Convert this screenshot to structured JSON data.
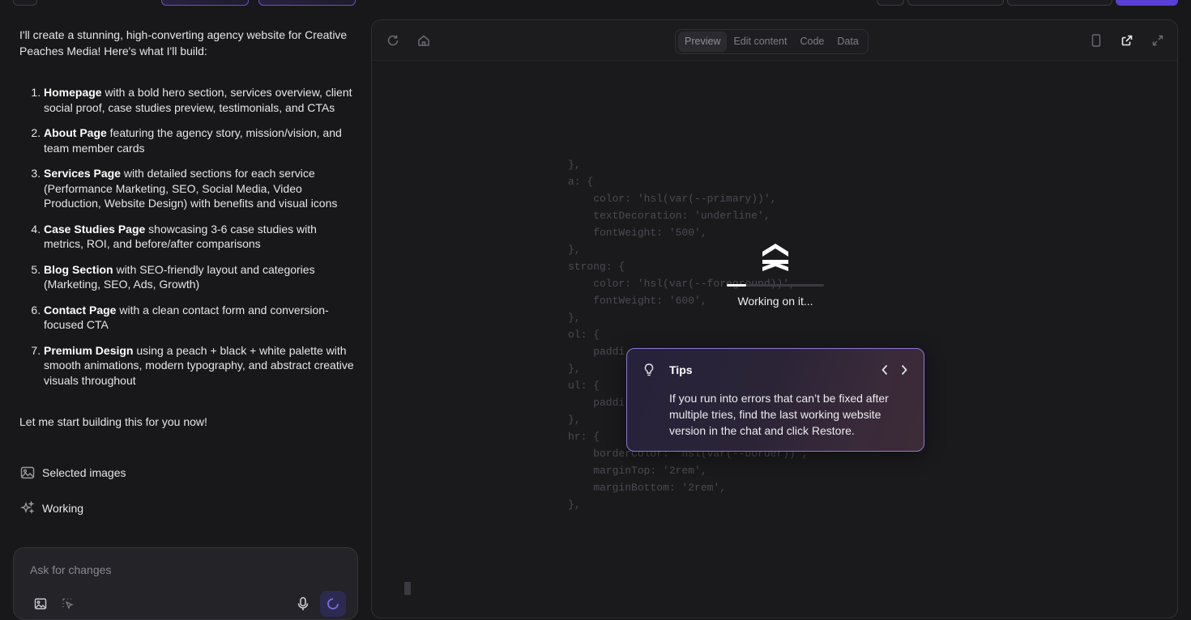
{
  "chat": {
    "intro": "I'll create a stunning, high-converting agency website for Creative Peaches Media! Here's what I'll build:",
    "items": [
      {
        "bold": "Homepage",
        "text": " with a bold hero section, services overview, client social proof, case studies preview, testimonials, and CTAs"
      },
      {
        "bold": "About Page",
        "text": " featuring the agency story, mission/vision, and team member cards"
      },
      {
        "bold": "Services Page",
        "text": " with detailed sections for each service (Performance Marketing, SEO, Social Media, Video Production, Website Design) with benefits and visual icons"
      },
      {
        "bold": "Case Studies Page",
        "text": " showcasing 3-6 case studies with metrics, ROI, and before/after comparisons"
      },
      {
        "bold": "Blog Section",
        "text": " with SEO-friendly layout and categories (Marketing, SEO, Ads, Growth)"
      },
      {
        "bold": "Contact Page",
        "text": " with a clean contact form and conversion-focused CTA"
      },
      {
        "bold": "Premium Design",
        "text": " using a peach + black + white palette with smooth animations, modern typography, and abstract creative visuals throughout"
      }
    ],
    "outro": "Let me start building this for you now!",
    "status_selected_images": "Selected images",
    "status_working": "Working"
  },
  "composer": {
    "placeholder": "Ask for changes",
    "value": ""
  },
  "preview": {
    "tabs": [
      {
        "label": "Preview",
        "active": true
      },
      {
        "label": "Edit content",
        "active": false
      },
      {
        "label": "Code",
        "active": false
      },
      {
        "label": "Data",
        "active": false
      }
    ],
    "code_lines": [
      {
        "t": "},"
      },
      {
        "t": "a: {"
      },
      {
        "t": "    color: 'hsl(var(--primary))',"
      },
      {
        "t": "    textDecoration: 'underline',"
      },
      {
        "t": "    fontWeight: '500',"
      },
      {
        "t": "},"
      },
      {
        "t": "strong: {"
      },
      {
        "t": "    color: 'hsl(var(--foreground))',"
      },
      {
        "t": "    fontWeight: '600',"
      },
      {
        "t": "},"
      },
      {
        "t": "ol: {"
      },
      {
        "t": "    paddi"
      },
      {
        "t": "},"
      },
      {
        "t": "ul: {"
      },
      {
        "t": "    paddi"
      },
      {
        "t": "},"
      },
      {
        "t": "hr: {"
      },
      {
        "t": "    borderColor: 'hsl(var(--border))',"
      },
      {
        "t": "    marginTop: '2rem',"
      },
      {
        "t": "    marginBottom: '2rem',"
      },
      {
        "t": "},"
      }
    ],
    "loader": {
      "label": "Working on it...",
      "progress": 0.2
    },
    "tips": {
      "title": "Tips",
      "body": "If you run into errors that can’t be fixed after multiple tries, find the last working website version in the chat and click Restore."
    }
  },
  "colors": {
    "accent": "#5a3fd6",
    "tips_border": "#8e78d8",
    "background": "#18181a"
  }
}
